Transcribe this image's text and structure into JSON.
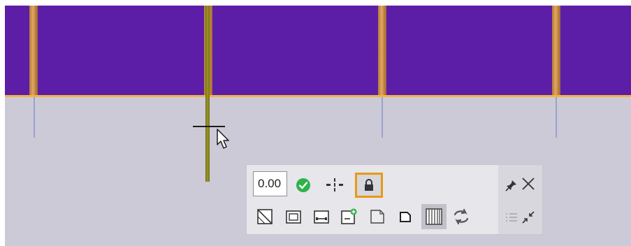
{
  "colors": {
    "top_band": "#5c1ea6",
    "canvas_bg": "#cdcad8",
    "edge_highlight": "#f3b247",
    "post": "#d49a55",
    "beam": "#8e8b20",
    "guide_line": "#9aa2cc",
    "confirm_green": "#2fb24a",
    "lock_outline": "#e89a12",
    "toolbar_bg": "#e6e6eb"
  },
  "toolbar": {
    "value_input": "0.00",
    "icons_row1": [
      "checkmark-confirm-icon",
      "split-line-icon",
      "lock-icon"
    ],
    "icons_row2": [
      "wall-corner-diagonal-icon",
      "rectangle-trim-icon",
      "end-to-end-icon",
      "add-panel-icon",
      "panel-page-icon",
      "small-panel-icon",
      "hatch-panel-icon",
      "swap-arrows-icon"
    ],
    "side_icons": [
      "pin-icon",
      "close-icon",
      "list-icon",
      "collapse-arrows-icon"
    ]
  }
}
